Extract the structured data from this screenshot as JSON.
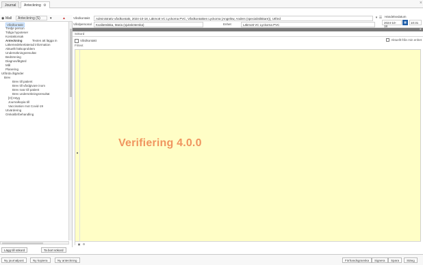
{
  "tabs": [
    {
      "label": "Journal"
    },
    {
      "label": "Anteckning"
    }
  ],
  "left": {
    "filter_label": "Mall",
    "filter_value": "Anteckning (S)",
    "add_button": "Lägg till sökord",
    "copy_button": "Ta bort sökord",
    "items": [
      {
        "label": "Vårdkontakt"
      },
      {
        "label": "Tredje person"
      },
      {
        "label": "Tidiga hypoteser"
      },
      {
        "label": "Kontaktorsak"
      },
      {
        "label": "Anteckning",
        "extra": "Texten att lägga in"
      },
      {
        "label": "Läkemedelsrelaterad information"
      },
      {
        "label": "Aktuellt hälsoproblem"
      },
      {
        "label": "Undersökningsresultat"
      },
      {
        "label": "Bedömning"
      },
      {
        "label": "Diagnos/åtgärd"
      },
      {
        "label": "Mål"
      },
      {
        "label": "Planering"
      },
      {
        "label": "Utförda åtgärder"
      },
      {
        "label": "Brev"
      },
      {
        "label": "Brev till patient"
      },
      {
        "label": "Brev till vårdgivare inom"
      },
      {
        "label": "Brev svar till patient"
      },
      {
        "label": "Brev undersökningsresultat"
      },
      {
        "label": "[O] Intyg"
      },
      {
        "label": "Journalkopia till"
      },
      {
        "label": "Vaccination mot Covid-19"
      },
      {
        "label": "Utvärdering"
      },
      {
        "label": "Omkalibr/behandling"
      }
    ]
  },
  "header": {
    "vardkontakt_label": "Vårdkontakt",
    "vardkontakt_value": "Administrativ vårdkontakt, 2024-10-18, Läkmott VC Lyckorna PVC, Vårdkontakten Lyckorna (Angelöw, Anders (specialistläkare)), Utförd",
    "signerare_label": "Vårdpersonal",
    "signerare_value": "Kvalitetsläka, Maria (sjuksköterska)",
    "enhet_label": "Enhet",
    "enhet_value": "Läkmott VC Lyckorna PVC",
    "date_label": "Händelsedatum",
    "date_value": "2024-10-18",
    "time_value": "10:31"
  },
  "content": {
    "sokord": "Sökord",
    "vardkontakt": "Vårdkontakt",
    "checkbox_label": "Aktuellt från min enhet",
    "fritext": "Fritext",
    "watermark": "Verifiering 4.0.0"
  },
  "bottom": {
    "left_buttons": [
      "Ny journalpost",
      "Ny kopiera",
      "Ny anteckning"
    ],
    "right_buttons": [
      "Förhandsgranska",
      "Signera",
      "Spara",
      "Stäng"
    ]
  }
}
